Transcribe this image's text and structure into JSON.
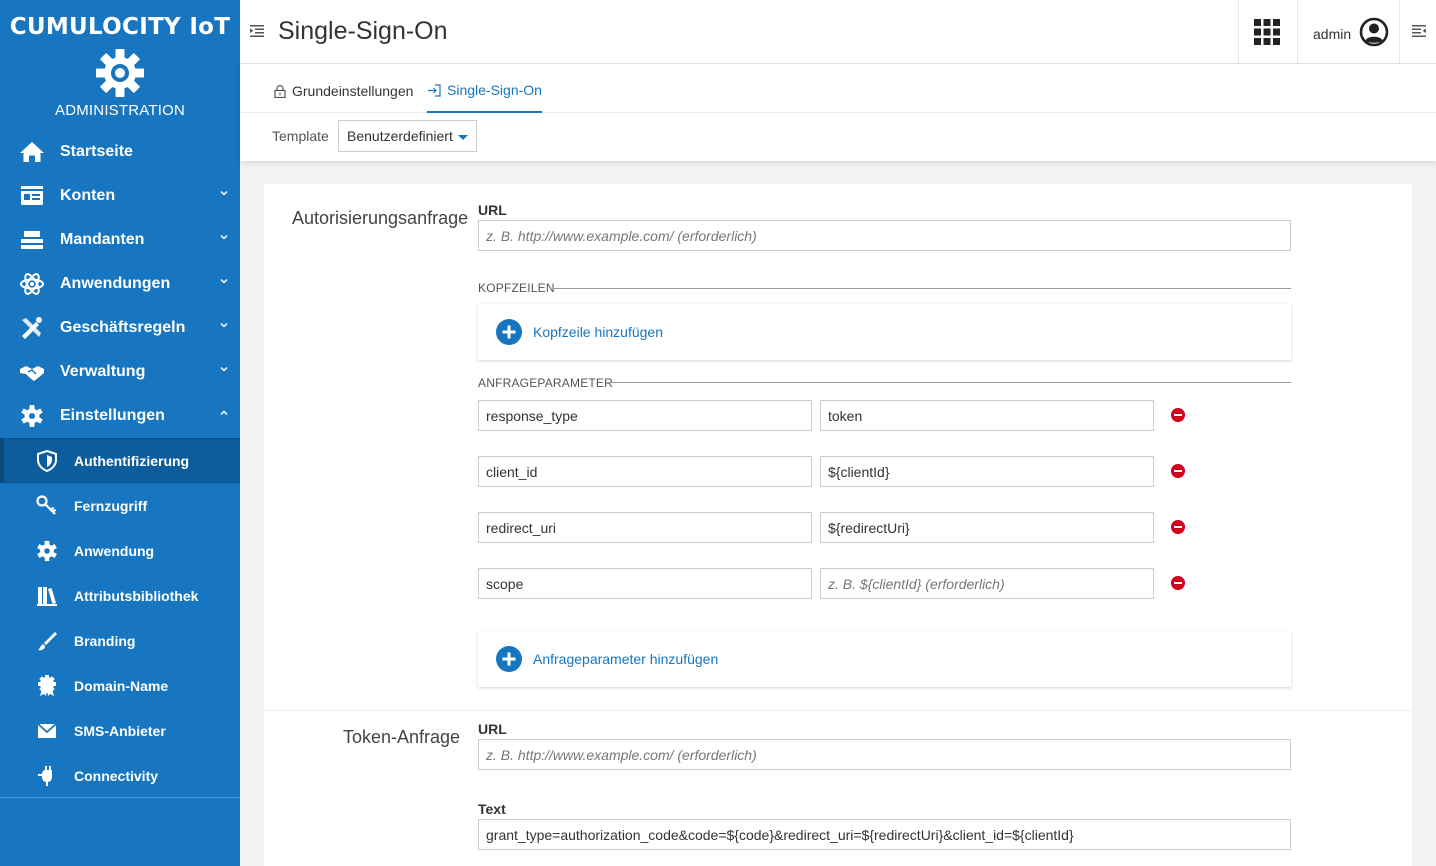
{
  "brand": {
    "title": "CUMULOCITY IoT",
    "subtitle": "ADMINISTRATION",
    "logo_icon": "gear-logo-icon"
  },
  "sidebar": {
    "items": [
      {
        "label": "Startseite",
        "icon": "home-icon"
      },
      {
        "label": "Konten",
        "icon": "accounts-icon"
      },
      {
        "label": "Mandanten",
        "icon": "tenants-icon"
      },
      {
        "label": "Anwendungen",
        "icon": "atom-icon"
      },
      {
        "label": "Geschäftsregeln",
        "icon": "tools-icon"
      },
      {
        "label": "Verwaltung",
        "icon": "handshake-icon"
      },
      {
        "label": "Einstellungen",
        "icon": "gear-icon"
      }
    ],
    "subitems": [
      {
        "label": "Authentifizierung",
        "icon": "shield-icon"
      },
      {
        "label": "Fernzugriff",
        "icon": "key-icon"
      },
      {
        "label": "Anwendung",
        "icon": "gear-icon"
      },
      {
        "label": "Attributsbibliothek",
        "icon": "library-icon"
      },
      {
        "label": "Branding",
        "icon": "brush-icon"
      },
      {
        "label": "Domain-Name",
        "icon": "badge-icon"
      },
      {
        "label": "SMS-Anbieter",
        "icon": "envelope-icon"
      },
      {
        "label": "Connectivity",
        "icon": "plug-icon"
      }
    ]
  },
  "header": {
    "title": "Single-Sign-On",
    "user": "admin"
  },
  "tabs": [
    {
      "label": "Grundeinstellungen",
      "icon": "lock-icon"
    },
    {
      "label": "Single-Sign-On",
      "icon": "sign-in-icon"
    }
  ],
  "template": {
    "label": "Template",
    "value": "Benutzerdefiniert"
  },
  "auth_request": {
    "title": "Autorisierungsanfrage",
    "url_label": "URL",
    "url_placeholder": "z. B. http://www.example.com/ (erforderlich)",
    "headers_title": "KOPFZEILEN",
    "add_header": "Kopfzeile hinzufügen",
    "params_title": "ANFRAGEPARAMETER",
    "params": [
      {
        "key": "response_type",
        "value": "token",
        "value_placeholder": ""
      },
      {
        "key": "client_id",
        "value": "${clientId}",
        "value_placeholder": ""
      },
      {
        "key": "redirect_uri",
        "value": "${redirectUri}",
        "value_placeholder": ""
      },
      {
        "key": "scope",
        "value": "",
        "value_placeholder": "z. B. ${clientId} (erforderlich)"
      }
    ],
    "add_param": "Anfrageparameter hinzufügen"
  },
  "token_request": {
    "title": "Token-Anfrage",
    "url_label": "URL",
    "url_placeholder": "z. B. http://www.example.com/ (erforderlich)",
    "body_label": "Text",
    "body_value": "grant_type=authorization_code&code=${code}&redirect_uri=${redirectUri}&client_id=${clientId}"
  },
  "colors": {
    "primary": "#1776bf",
    "active_nav": "#0d5d9c",
    "danger": "#d0021b"
  }
}
